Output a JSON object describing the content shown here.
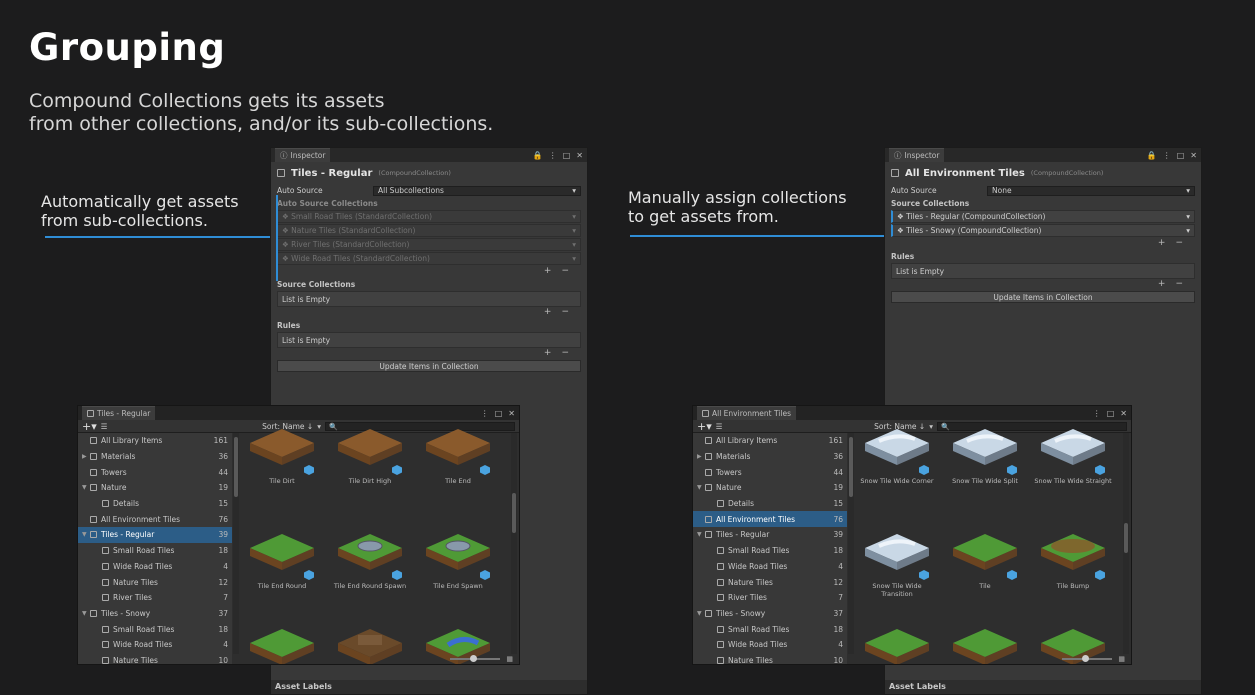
{
  "slide": {
    "title": "Grouping",
    "subtitle": "Compound Collections gets its assets\nfrom other collections, and/or its sub-collections.",
    "left_callout": "Automatically get assets\n from sub-collections.",
    "right_callout": "Manually assign collections\nto get assets from.",
    "accent": "#2f8dd6"
  },
  "left_inspector": {
    "tab": "Inspector",
    "title": "Tiles - Regular",
    "type": "(CompoundCollection)",
    "auto_source_label": "Auto Source",
    "auto_source_value": "All Subcollections",
    "auto_source_collections_label": "Auto Source Collections",
    "auto_items": [
      "Small Road Tiles (StandardCollection)",
      "Nature Tiles (StandardCollection)",
      "River Tiles (StandardCollection)",
      "Wide Road Tiles (StandardCollection)"
    ],
    "source_collections_label": "Source Collections",
    "source_empty": "List is Empty",
    "rules_label": "Rules",
    "rules_empty": "List is Empty",
    "update_button": "Update Items in Collection",
    "asset_labels": "Asset Labels"
  },
  "right_inspector": {
    "tab": "Inspector",
    "title": "All Environment Tiles",
    "type": "(CompoundCollection)",
    "auto_source_label": "Auto Source",
    "auto_source_value": "None",
    "source_collections_label": "Source Collections",
    "source_items": [
      "Tiles - Regular (CompoundCollection)",
      "Tiles - Snowy (CompoundCollection)"
    ],
    "rules_label": "Rules",
    "rules_empty": "List is Empty",
    "update_button": "Update Items in Collection",
    "asset_labels": "Asset Labels"
  },
  "left_browser": {
    "tab": "Tiles - Regular",
    "sort": "Sort: Name ↓",
    "tree": [
      {
        "name": "All Library Items",
        "count": "161",
        "indent": 0,
        "arrow": ""
      },
      {
        "name": "Materials",
        "count": "36",
        "indent": 0,
        "arrow": "▶"
      },
      {
        "name": "Towers",
        "count": "44",
        "indent": 0,
        "arrow": ""
      },
      {
        "name": "Nature",
        "count": "19",
        "indent": 0,
        "arrow": "▼"
      },
      {
        "name": "Details",
        "count": "15",
        "indent": 1,
        "arrow": ""
      },
      {
        "name": "All Environment Tiles",
        "count": "76",
        "indent": 0,
        "arrow": ""
      },
      {
        "name": "Tiles - Regular",
        "count": "39",
        "indent": 0,
        "arrow": "▼",
        "selected": true
      },
      {
        "name": "Small Road Tiles",
        "count": "18",
        "indent": 1,
        "arrow": ""
      },
      {
        "name": "Wide Road Tiles",
        "count": "4",
        "indent": 1,
        "arrow": ""
      },
      {
        "name": "Nature Tiles",
        "count": "12",
        "indent": 1,
        "arrow": ""
      },
      {
        "name": "River Tiles",
        "count": "7",
        "indent": 1,
        "arrow": ""
      },
      {
        "name": "Tiles - Snowy",
        "count": "37",
        "indent": 0,
        "arrow": "▼"
      },
      {
        "name": "Small Road Tiles",
        "count": "18",
        "indent": 1,
        "arrow": ""
      },
      {
        "name": "Wide Road Tiles",
        "count": "4",
        "indent": 1,
        "arrow": ""
      },
      {
        "name": "Nature Tiles",
        "count": "10",
        "indent": 1,
        "arrow": ""
      }
    ],
    "tiles": [
      {
        "name": "Tile Dirt",
        "kind": "dirt"
      },
      {
        "name": "Tile Dirt High",
        "kind": "dirt"
      },
      {
        "name": "Tile End",
        "kind": "dirt"
      },
      {
        "name": "Tile End Round",
        "kind": "grass"
      },
      {
        "name": "Tile End Round Spawn",
        "kind": "spawn"
      },
      {
        "name": "Tile End Spawn",
        "kind": "spawn"
      },
      {
        "name": "",
        "kind": "grass"
      },
      {
        "name": "",
        "kind": "road"
      },
      {
        "name": "",
        "kind": "river"
      }
    ]
  },
  "right_browser": {
    "tab": "All Environment Tiles",
    "sort": "Sort: Name ↓",
    "tree": [
      {
        "name": "All Library Items",
        "count": "161",
        "indent": 0,
        "arrow": ""
      },
      {
        "name": "Materials",
        "count": "36",
        "indent": 0,
        "arrow": "▶"
      },
      {
        "name": "Towers",
        "count": "44",
        "indent": 0,
        "arrow": ""
      },
      {
        "name": "Nature",
        "count": "19",
        "indent": 0,
        "arrow": "▼"
      },
      {
        "name": "Details",
        "count": "15",
        "indent": 1,
        "arrow": ""
      },
      {
        "name": "All Environment Tiles",
        "count": "76",
        "indent": 0,
        "arrow": "",
        "selected": true
      },
      {
        "name": "Tiles - Regular",
        "count": "39",
        "indent": 0,
        "arrow": "▼"
      },
      {
        "name": "Small Road Tiles",
        "count": "18",
        "indent": 1,
        "arrow": ""
      },
      {
        "name": "Wide Road Tiles",
        "count": "4",
        "indent": 1,
        "arrow": ""
      },
      {
        "name": "Nature Tiles",
        "count": "12",
        "indent": 1,
        "arrow": ""
      },
      {
        "name": "River Tiles",
        "count": "7",
        "indent": 1,
        "arrow": ""
      },
      {
        "name": "Tiles - Snowy",
        "count": "37",
        "indent": 0,
        "arrow": "▼"
      },
      {
        "name": "Small Road Tiles",
        "count": "18",
        "indent": 1,
        "arrow": ""
      },
      {
        "name": "Wide Road Tiles",
        "count": "4",
        "indent": 1,
        "arrow": ""
      },
      {
        "name": "Nature Tiles",
        "count": "10",
        "indent": 1,
        "arrow": ""
      }
    ],
    "tiles": [
      {
        "name": "Snow Tile Wide Corner",
        "kind": "snow"
      },
      {
        "name": "Snow Tile Wide Split",
        "kind": "snow"
      },
      {
        "name": "Snow Tile Wide Straight",
        "kind": "snow"
      },
      {
        "name": "Snow Tile Wide Transition",
        "kind": "snow"
      },
      {
        "name": "Tile",
        "kind": "grass"
      },
      {
        "name": "Tile Bump",
        "kind": "bump"
      },
      {
        "name": "",
        "kind": "grass"
      },
      {
        "name": "",
        "kind": "grass"
      },
      {
        "name": "",
        "kind": "grass"
      }
    ]
  }
}
